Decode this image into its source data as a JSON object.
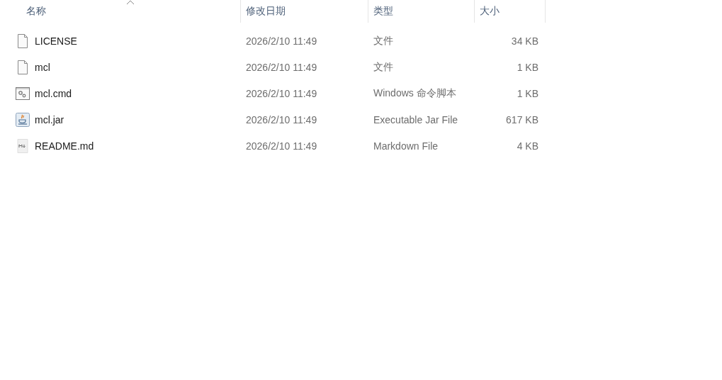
{
  "columns": [
    {
      "label": "名称",
      "sorted": true
    },
    {
      "label": "修改日期",
      "sorted": false
    },
    {
      "label": "类型",
      "sorted": false
    },
    {
      "label": "大小",
      "sorted": false
    }
  ],
  "files": [
    {
      "kind": "file",
      "name": "LICENSE",
      "modified": "2026/2/10 11:49",
      "type": "文件",
      "size": "34 KB"
    },
    {
      "kind": "file",
      "name": "mcl",
      "modified": "2026/2/10 11:49",
      "type": "文件",
      "size": "1 KB"
    },
    {
      "kind": "script",
      "name": "mcl.cmd",
      "modified": "2026/2/10 11:49",
      "type": "Windows 命令脚本",
      "size": "1 KB"
    },
    {
      "kind": "jar",
      "name": "mcl.jar",
      "modified": "2026/2/10 11:49",
      "type": "Executable Jar File",
      "size": "617 KB"
    },
    {
      "kind": "markdown",
      "name": "README.md",
      "modified": "2026/2/10 11:49",
      "type": "Markdown File",
      "size": "4 KB"
    }
  ]
}
